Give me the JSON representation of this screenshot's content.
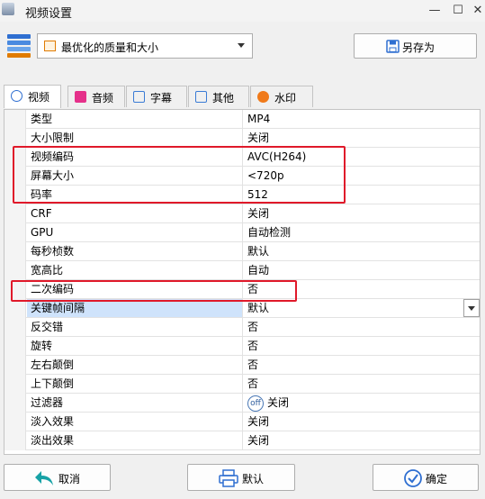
{
  "window": {
    "title": "视频设置",
    "minimize": "—",
    "maximize": "☐",
    "close": "✕"
  },
  "preset": {
    "selected": "最优化的质量和大小",
    "save_as_label": "另存为"
  },
  "tabs": [
    {
      "label": "视频",
      "icon": "video-icon",
      "color": "#2f6fd1"
    },
    {
      "label": "音频",
      "icon": "music-icon",
      "color": "#e5308a"
    },
    {
      "label": "字幕",
      "icon": "subtitle-icon",
      "color": "#3a7bd5"
    },
    {
      "label": "其他",
      "icon": "sliders-icon",
      "color": "#3a7bd5"
    },
    {
      "label": "水印",
      "icon": "watermark-icon",
      "color": "#f07a1a"
    }
  ],
  "properties": [
    {
      "name": "类型",
      "value": "MP4"
    },
    {
      "name": "大小限制",
      "value": "关闭"
    },
    {
      "name": "视频编码",
      "value": "AVC(H264)"
    },
    {
      "name": "屏幕大小",
      "value": "<720p"
    },
    {
      "name": "码率",
      "value": "512"
    },
    {
      "name": "CRF",
      "value": "关闭"
    },
    {
      "name": "GPU",
      "value": "自动检测"
    },
    {
      "name": "每秒桢数",
      "value": "默认"
    },
    {
      "name": "宽高比",
      "value": "自动"
    },
    {
      "name": "二次编码",
      "value": "否"
    },
    {
      "name": "关键帧间隔",
      "value": "默认"
    },
    {
      "name": "反交错",
      "value": "否"
    },
    {
      "name": "旋转",
      "value": "否"
    },
    {
      "name": "左右颠倒",
      "value": "否"
    },
    {
      "name": "上下颠倒",
      "value": "否"
    },
    {
      "name": "过滤器",
      "value": "关闭",
      "icon_text": "off"
    },
    {
      "name": "淡入效果",
      "value": "关闭"
    },
    {
      "name": "淡出效果",
      "value": "关闭"
    }
  ],
  "footer": {
    "cancel_label": "取消",
    "default_label": "默认",
    "ok_label": "确定"
  },
  "colors": {
    "highlight_box": "#e0192a",
    "selected_row": "#cfe3fb"
  }
}
